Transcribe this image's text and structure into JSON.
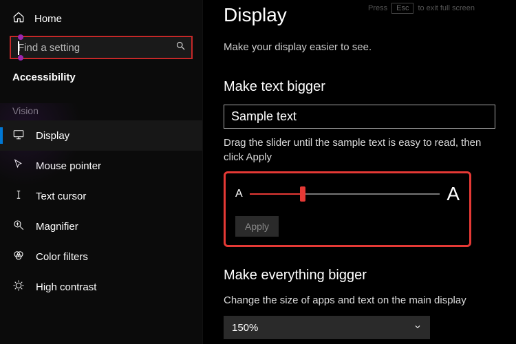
{
  "sidebar": {
    "home": "Home",
    "search_placeholder": "Find a setting",
    "section": "Accessibility",
    "group": "Vision",
    "items": [
      {
        "label": "Display",
        "icon": "display"
      },
      {
        "label": "Mouse pointer",
        "icon": "mouse"
      },
      {
        "label": "Text cursor",
        "icon": "textcursor"
      },
      {
        "label": "Magnifier",
        "icon": "magnifier"
      },
      {
        "label": "Color filters",
        "icon": "colorfilters"
      },
      {
        "label": "High contrast",
        "icon": "highcontrast"
      }
    ]
  },
  "esc_hint": {
    "pre": "Press",
    "key": "Esc",
    "post": "to exit full screen"
  },
  "main": {
    "title": "Display",
    "subtitle": "Make your display easier to see.",
    "make_text_bigger": {
      "heading": "Make text bigger",
      "sample": "Sample text",
      "instruction": "Drag the slider until the sample text is easy to read, then click Apply",
      "small_a": "A",
      "big_a": "A",
      "apply": "Apply",
      "slider_percent": 28
    },
    "make_everything_bigger": {
      "heading": "Make everything bigger",
      "instruction": "Change the size of apps and text on the main display",
      "value": "150%"
    }
  }
}
